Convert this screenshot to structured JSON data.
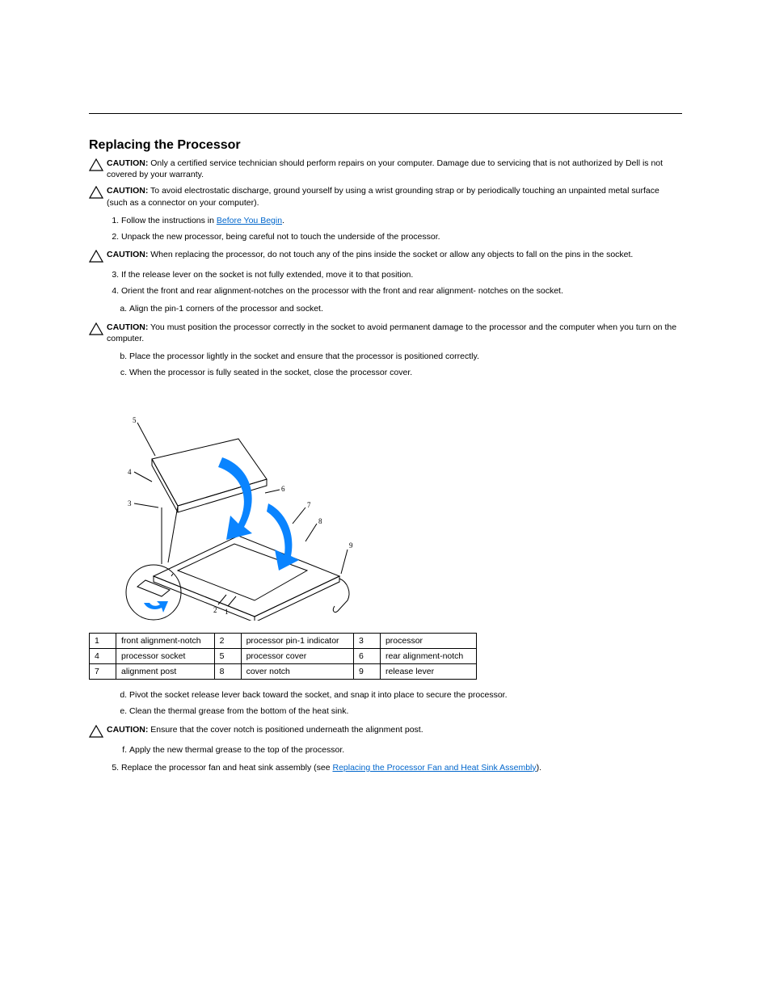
{
  "section": {
    "title": "Replacing the Processor"
  },
  "cautions": {
    "c1_label": "CAUTION:",
    "c1_text": " Only a certified service technician should perform repairs on your computer. Damage due to servicing that is not authorized by Dell is not covered by your warranty.",
    "c2_label": "CAUTION:",
    "c2_text_a": " To avoid electrostatic discharge, ground yourself by using a wrist grounding strap or by periodically touching an unpainted metal surface (such as a connector on your computer).",
    "c3_label": "CAUTION:",
    "c3_text": " When replacing the processor, do not touch any of the pins inside the socket or allow any objects to fall on the pins in the socket.",
    "c4_label": "CAUTION:",
    "c4_text": " You must position the processor correctly in the socket to avoid permanent damage to the processor and the computer when you turn on the computer.",
    "c5_label": "CAUTION:",
    "c5_text": " Ensure that the cover notch is positioned underneath the alignment post."
  },
  "steps": {
    "s1_a": "Follow the instructions in ",
    "s1_link": "Before You Begin",
    "s1_b": ".",
    "s2": "Unpack the new processor, being careful not to touch the underside of the processor.",
    "s3": "If the release lever on the socket is not fully extended, move it to that position.",
    "s4_intro": "Orient the front and rear alignment-notches on the processor with the front and rear alignment- notches on the socket.",
    "s4_body1": "Align the pin-1 corners of the processor and socket.",
    "s4_body2": "Place the processor lightly in the socket and ensure that the processor is positioned correctly.",
    "s4_body3": "When the processor is fully seated in the socket, close the processor cover.",
    "s5": "Pivot the socket release lever back toward the socket, and snap it into place to secure the processor.",
    "s6": "Clean the thermal grease from the bottom of the heat sink.",
    "s7": "Apply the new thermal grease to the top of the processor.",
    "s8_a": "Replace the processor fan and heat sink assembly (see ",
    "s8_link": "Replacing the Processor Fan and Heat Sink Assembly",
    "s8_b": ")."
  },
  "legend": {
    "r1c1n": "1",
    "r1c1t": "front alignment-notch",
    "r1c2n": "2",
    "r1c2t": "processor pin-1 indicator",
    "r1c3n": "3",
    "r1c3t": "processor",
    "r2c1n": "4",
    "r2c1t": "processor socket",
    "r2c2n": "5",
    "r2c2t": "processor cover",
    "r2c3n": "6",
    "r2c3t": "rear alignment-notch",
    "r3c1n": "7",
    "r3c1t": "alignment post",
    "r3c2n": "8",
    "r3c2t": "cover notch",
    "r3c3n": "9",
    "r3c3t": "release lever"
  }
}
